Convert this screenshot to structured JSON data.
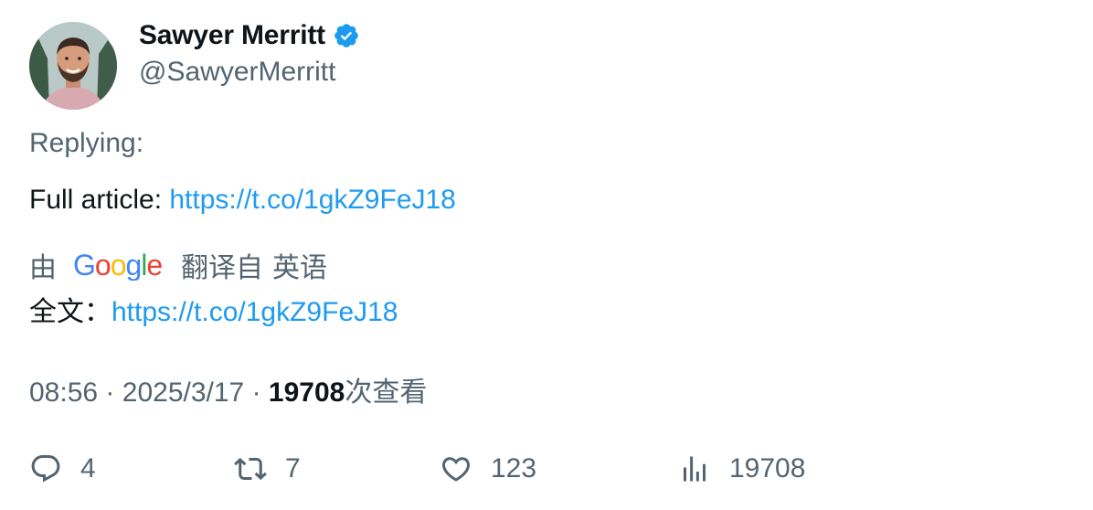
{
  "author": {
    "display_name": "Sawyer Merritt",
    "handle": "@SawyerMerritt",
    "verified": true,
    "verified_color": "#1d9bf0"
  },
  "tweet": {
    "replying_label": "Replying:",
    "text_prefix": "Full article: ",
    "link": "https://t.co/1gkZ9FeJ18"
  },
  "translation": {
    "by_label": "由",
    "provider": "Google",
    "translated_from_label": "翻译自",
    "source_language": "英语",
    "text_prefix": "全文：",
    "link": "https://t.co/1gkZ9FeJ18"
  },
  "meta": {
    "time": "08:56",
    "separator": "·",
    "date": "2025/3/17",
    "views_count": "19708",
    "views_label": "次查看"
  },
  "actions": {
    "reply_count": "4",
    "retweet_count": "7",
    "like_count": "123",
    "views_count": "19708"
  },
  "icons": {
    "reply": "reply-icon",
    "retweet": "retweet-icon",
    "like": "heart-icon",
    "views": "views-chart-icon",
    "verified": "verified-badge-icon"
  },
  "colors": {
    "link": "#1d9bf0",
    "secondary_text": "#536471",
    "primary_text": "#0f1419"
  }
}
